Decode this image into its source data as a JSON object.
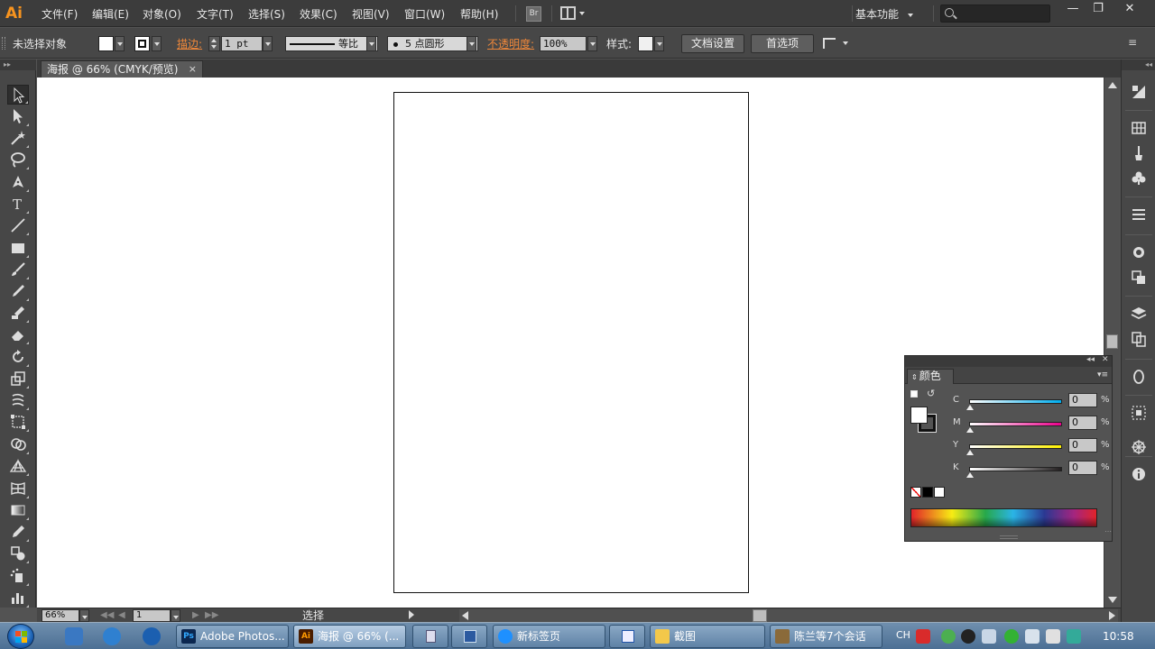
{
  "app": {
    "logo": "Ai"
  },
  "menu": {
    "items": [
      "文件(F)",
      "编辑(E)",
      "对象(O)",
      "文字(T)",
      "选择(S)",
      "效果(C)",
      "视图(V)",
      "窗口(W)",
      "帮助(H)"
    ],
    "bridge": "Br",
    "workspace": "基本功能",
    "search_placeholder": "",
    "window_buttons": [
      "minimize-icon",
      "restore-icon",
      "close-icon"
    ]
  },
  "control": {
    "selection_label": "未选择对象",
    "stroke_label": "描边:",
    "stroke_weight": "1 pt",
    "stroke_profile": "等比",
    "brush": "5 点圆形",
    "opacity_label": "不透明度:",
    "opacity_value": "100%",
    "style_label": "样式:",
    "doc_setup_button": "文档设置",
    "preferences_button": "首选项"
  },
  "tools": [
    "selection-tool-icon",
    "direct-selection-tool-icon",
    "magic-wand-tool-icon",
    "lasso-tool-icon",
    "pen-tool-icon",
    "type-tool-icon",
    "line-segment-tool-icon",
    "rectangle-tool-icon",
    "paintbrush-tool-icon",
    "pencil-tool-icon",
    "blob-brush-tool-icon",
    "eraser-tool-icon",
    "rotate-tool-icon",
    "scale-tool-icon",
    "warp-tool-icon",
    "free-transform-tool-icon",
    "shape-builder-tool-icon",
    "perspective-grid-tool-icon",
    "mesh-tool-icon",
    "gradient-tool-icon",
    "eyedropper-tool-icon",
    "blend-tool-icon",
    "symbol-sprayer-tool-icon",
    "column-graph-tool-icon"
  ],
  "document": {
    "tab_title": "海报 @ 66% (CMYK/预览)",
    "tab_close": "×"
  },
  "status": {
    "zoom": "66%",
    "artboard": "1",
    "tool_name": "选择"
  },
  "color_panel": {
    "tab": "颜色",
    "channels": [
      {
        "name": "C",
        "value": "0",
        "unit": "%",
        "gradient_end": "#00aeef"
      },
      {
        "name": "M",
        "value": "0",
        "unit": "%",
        "gradient_end": "#ec008c"
      },
      {
        "name": "Y",
        "value": "0",
        "unit": "%",
        "gradient_end": "#fff200"
      },
      {
        "name": "K",
        "value": "0",
        "unit": "%",
        "gradient_end": "#231f20"
      }
    ]
  },
  "dock_icons": [
    "color-guide-icon",
    "swatches-icon",
    "brushes-icon",
    "symbols-icon",
    "stroke-icon",
    "appearance-icon",
    "graphic-styles-icon",
    "layers-icon",
    "artboards-icon",
    "transparency-icon",
    "align-icon",
    "navigator-icon",
    "info-icon"
  ],
  "taskbar": {
    "items": [
      {
        "label": "Adobe Photos...",
        "icon": "Ps",
        "active": false
      },
      {
        "label": "海报 @ 66% (...",
        "icon": "Ai",
        "active": true
      },
      {
        "label": "新标签页",
        "icon": "",
        "active": false
      },
      {
        "label": "截图",
        "icon": "",
        "active": false
      },
      {
        "label": "陈兰等7个会话",
        "icon": "",
        "active": false
      }
    ],
    "ime": "CH",
    "clock": "10:58"
  }
}
